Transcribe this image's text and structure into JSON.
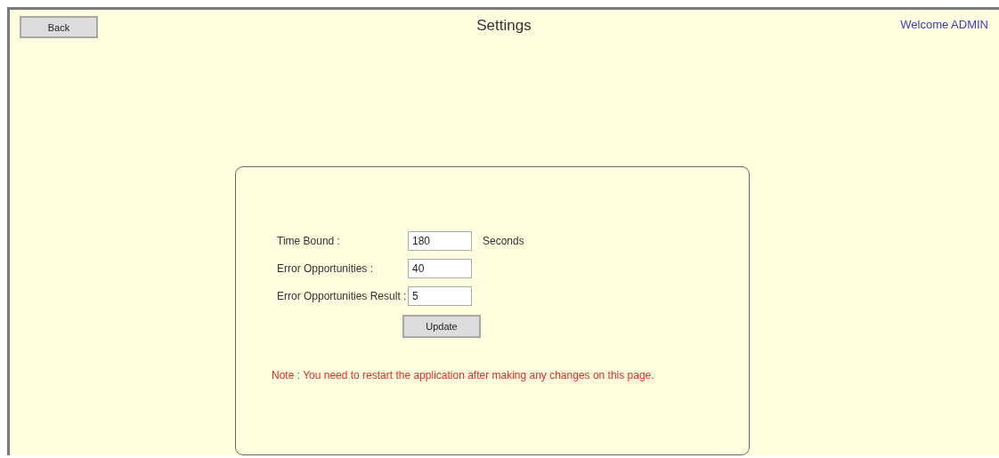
{
  "header": {
    "back_button": "Back",
    "title": "Settings",
    "welcome": "Welcome ADMIN"
  },
  "fields": [
    {
      "label": "Time Bound :",
      "value": "180",
      "unit": "Seconds"
    },
    {
      "label": "Error Opportunities :",
      "value": "40"
    },
    {
      "label": "Error Opportunities Result :",
      "value": "5"
    }
  ],
  "update_button": "Update",
  "note": "Note : You need to restart the application after making any changes on this page."
}
